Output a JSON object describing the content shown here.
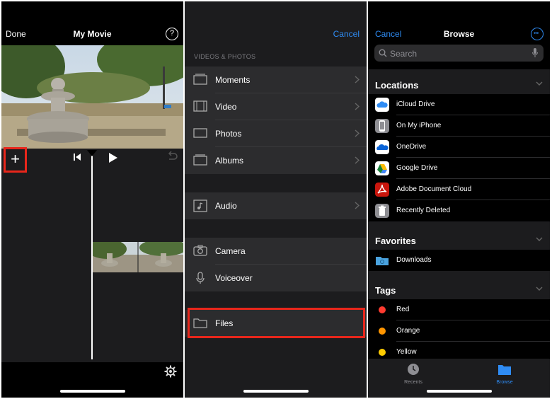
{
  "editor": {
    "done_label": "Done",
    "title": "My Movie",
    "help_icon": "?",
    "add_icon": "+"
  },
  "import": {
    "cancel_label": "Cancel",
    "section_label": "VIDEOS & PHOTOS",
    "items": [
      {
        "label": "Moments",
        "icon": "moments-icon"
      },
      {
        "label": "Video",
        "icon": "film-icon"
      },
      {
        "label": "Photos",
        "icon": "photo-icon"
      },
      {
        "label": "Albums",
        "icon": "albums-icon"
      },
      {
        "label": "Audio",
        "icon": "music-icon"
      },
      {
        "label": "Camera",
        "icon": "camera-icon"
      },
      {
        "label": "Voiceover",
        "icon": "microphone-icon"
      },
      {
        "label": "Files",
        "icon": "folder-icon"
      }
    ]
  },
  "browse": {
    "cancel_label": "Cancel",
    "title": "Browse",
    "search_placeholder": "Search",
    "locations_title": "Locations",
    "locations": [
      {
        "label": "iCloud Drive",
        "color": "#2f8cf4"
      },
      {
        "label": "On My iPhone",
        "color": "#8e8e93"
      },
      {
        "label": "OneDrive",
        "color": "#0a64d8"
      },
      {
        "label": "Google Drive",
        "color": "#ffffff"
      },
      {
        "label": "Adobe Document Cloud",
        "color": "#c9160d"
      },
      {
        "label": "Recently Deleted",
        "color": "#8e8e93"
      }
    ],
    "favorites_title": "Favorites",
    "favorites": [
      {
        "label": "Downloads",
        "color": "#4aa3df"
      }
    ],
    "tags_title": "Tags",
    "tags": [
      {
        "label": "Red",
        "color": "#ff3b30"
      },
      {
        "label": "Orange",
        "color": "#ff9500"
      },
      {
        "label": "Yellow",
        "color": "#ffcc00"
      }
    ],
    "tabs": [
      {
        "label": "Recents",
        "active": false
      },
      {
        "label": "Browse",
        "active": true
      }
    ]
  },
  "colors": {
    "accent": "#2f8cf4",
    "highlight": "#e8261b"
  }
}
